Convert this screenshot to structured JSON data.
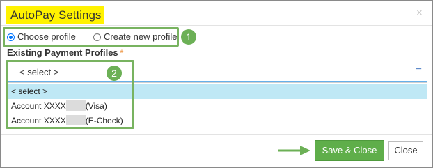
{
  "dialog": {
    "title": "AutoPay Settings",
    "close_icon": "×"
  },
  "profile_mode": {
    "options": [
      "Choose profile",
      "Create new profile"
    ],
    "selected": "Choose profile"
  },
  "callouts": [
    "1",
    "2"
  ],
  "existing_profiles": {
    "label": "Existing Payment Profiles",
    "required_marker": "*",
    "current_value": "< select >",
    "toggle_icon": "−",
    "options": [
      {
        "name": "< select >",
        "highlighted": true
      },
      {
        "prefix": "Account XXXX",
        "suffix": "(Visa)",
        "masked": true
      },
      {
        "prefix": "Account XXXX",
        "suffix": "(E-Check)",
        "masked": true
      }
    ]
  },
  "footer": {
    "save_label": "Save & Close",
    "close_label": "Close"
  },
  "colors": {
    "title_highlight": "#fff200",
    "annotation_green": "#6cb056",
    "save_button": "#5fae4a",
    "selected_option": "#bfe8f5"
  }
}
